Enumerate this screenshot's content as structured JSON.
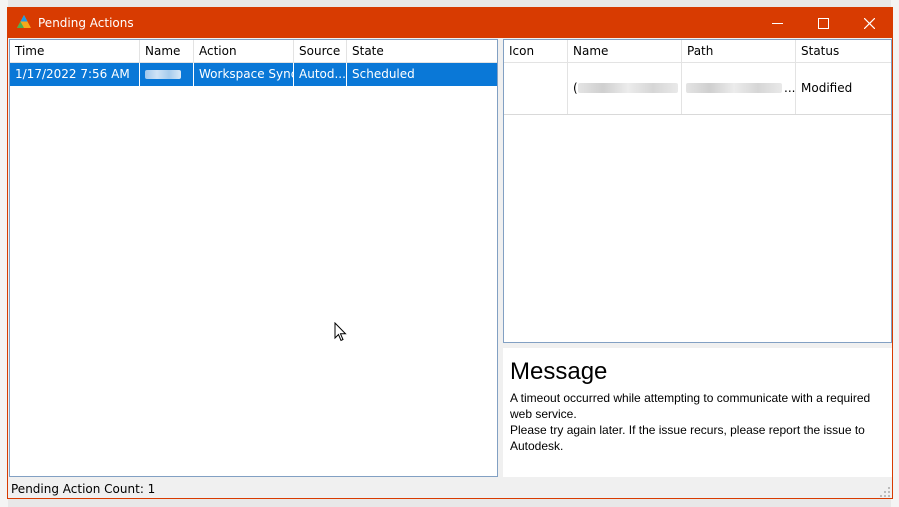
{
  "window": {
    "title": "Pending Actions",
    "accent": "#d83b01"
  },
  "actions_list": {
    "columns": [
      "Time",
      "Name",
      "Action",
      "Source",
      "State"
    ],
    "rows": [
      {
        "time": "1/17/2022 7:56 AM",
        "name": "",
        "action": "Workspace Sync",
        "source": "Autod...",
        "state": "Scheduled"
      }
    ]
  },
  "details_grid": {
    "columns": [
      "Icon",
      "Name",
      "Path",
      "Status"
    ],
    "rows": [
      {
        "icon": "",
        "name": "(",
        "path": "...",
        "status": "Modified"
      }
    ]
  },
  "message": {
    "heading": "Message",
    "lines": [
      "A timeout occurred while attempting to communicate with a required web service.",
      "Please try again later.  If the issue recurs, please report the issue to Autodesk."
    ]
  },
  "status": {
    "text": "Pending Action Count: 1"
  }
}
